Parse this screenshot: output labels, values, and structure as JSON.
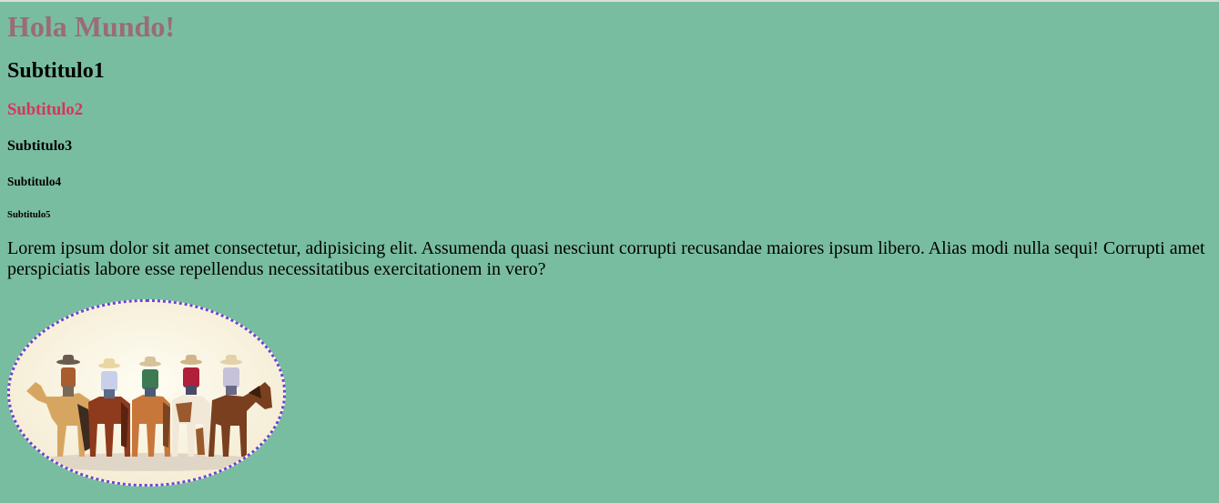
{
  "page": {
    "title": "Hola Mundo!",
    "subtitles": [
      "Subtitulo1",
      "Subtitulo2",
      "Subtitulo3",
      "Subtitulo4",
      "Subtitulo5"
    ],
    "paragraph": "Lorem ipsum dolor sit amet consectetur, adipisicing elit. Assumenda quasi nesciunt corrupti recusandae maiores ipsum libero. Alias modi nulla sequi! Corrupti amet perspiciatis labore esse repellendus necessitatibus exercitationem in vero?",
    "image": {
      "subject": "five cowboys on horses, seen from behind",
      "icon": "cowboys-illustration"
    }
  },
  "colors": {
    "background": "#79bda1",
    "title": "#9b6b77",
    "subtitle2": "#d7345c",
    "image_border": "#6b45d7"
  }
}
